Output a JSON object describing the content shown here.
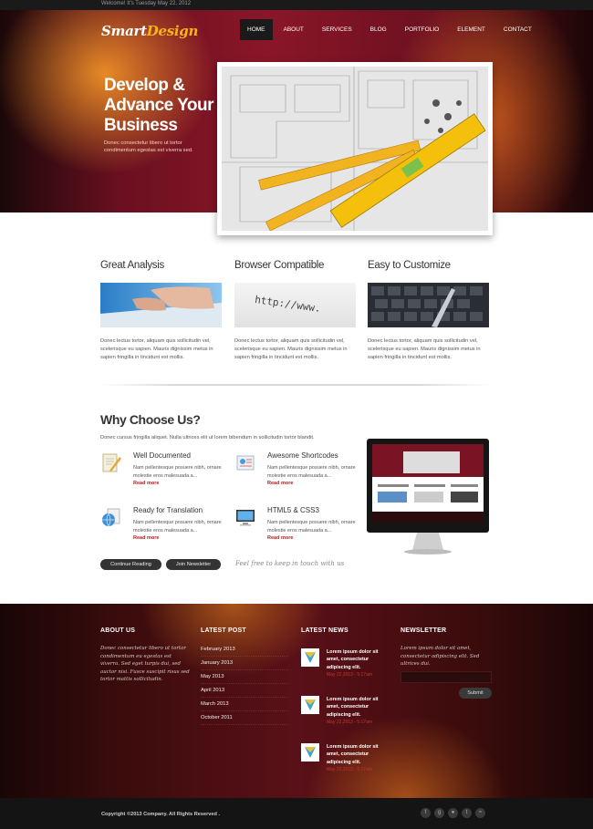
{
  "topbar": {
    "welcome": "Welcome! It's Tuesday May 22, 2012"
  },
  "header": {
    "logo_part1": "Smart",
    "logo_part2": "Design",
    "nav": [
      "HOME",
      "ABOUT",
      "SERVICES",
      "BLOG",
      "PORTFOLIO",
      "ELEMENT",
      "CONTACT"
    ],
    "active_nav": "HOME"
  },
  "hero": {
    "title": "Develop & Advance Your Business",
    "text": "Donec consectetur libero ut tortor condimentum egestas est viverra sed."
  },
  "features": [
    {
      "title": "Great Analysis",
      "text": "Donec lectus tortor, aliquam quis sollicitudin vel, scelerisque eu sapien. Mauris dignissim metus in sapien fringilla in tincidunt est mollis."
    },
    {
      "title": "Browser Compatible",
      "text": "Donec lectus tortor, aliquam quis sollicitudin vel, scelerisque eu sapien. Mauris dignissim metus in sapien fringilla in tincidunt est mollis."
    },
    {
      "title": "Easy to Customize",
      "text": "Donec lectus tortor, aliquam quis sollicitudin vel, scelerisque eu sapien. Mauris dignissim metus in sapien fringilla in tincidunt est mollis."
    }
  ],
  "browser_thumb_text": "http://www.",
  "why": {
    "title": "Why Choose Us?",
    "intro": "Donec cursus fringilla aliquet. Nulla ultrices elit ut lorem bibendum in sollicitudin tortor blandit.",
    "items": [
      {
        "title": "Well Documented",
        "text": "Nam pellentesque posuere nibh, ornare molestie eros malesuada a...",
        "more": "Read more"
      },
      {
        "title": "Awesome Shortcodes",
        "text": "Nam pellentesque posuere nibh, ornare molestie eros malesuada a...",
        "more": "Read more"
      },
      {
        "title": "Ready for Translation",
        "text": "Nam pellentesque posuere nibh, ornare molestie eros malesuada a...",
        "more": "Read more"
      },
      {
        "title": "HTML5 & CSS3",
        "text": "Nam pellentesque posuere nibh, ornare molestie eros malesuada a...",
        "more": "Read more"
      }
    ],
    "btn_continue": "Continue Reading",
    "btn_join": "Join Newsletter",
    "tagline": "Feel free to keep in touch with us"
  },
  "footer": {
    "about_title": "ABOUT US",
    "about_text": "Donec consectetur libero ut tortor condimentum eu egestas est viverra. Sed eget turpis dui, sed auctor nisi. Fusce suscipit risus sed tortor mattis sollicitudin.",
    "posts_title": "LATEST POST",
    "posts": [
      "February 2013",
      "January 2013",
      "May 2013",
      "April 2013",
      "March 2013",
      "October 2011"
    ],
    "news_title": "LATEST NEWS",
    "news": [
      {
        "text": "Lorem ipsum dolor sit amet, consectetur adipiscing elit.",
        "date": "May 22,2013 - 5:17am"
      },
      {
        "text": "Lorem ipsum dolor sit amet, consectetur adipiscing elit.",
        "date": "May 22,2013 - 5:17am"
      },
      {
        "text": "Lorem ipsum dolor sit amet, consectetur adipiscing elit.",
        "date": "May 22,2013 - 5:17am"
      }
    ],
    "newsletter_title": "NEWSLETTER",
    "newsletter_text": "Lorem ipsum dolor sit amet, consectetur adipiscing elit. Sed ultrices dui.",
    "newsletter_placeholder": "",
    "submit": "Submit",
    "copyright": "Copyright ©2013 Company. All Rights Reserved .",
    "social": [
      "facebook-icon",
      "google-plus-icon",
      "flickr-icon",
      "twitter-icon",
      "rss-icon"
    ]
  },
  "colors": {
    "accent_red": "#8a1628",
    "logo_yellow": "#f7b21c",
    "read_more": "#b02020"
  }
}
